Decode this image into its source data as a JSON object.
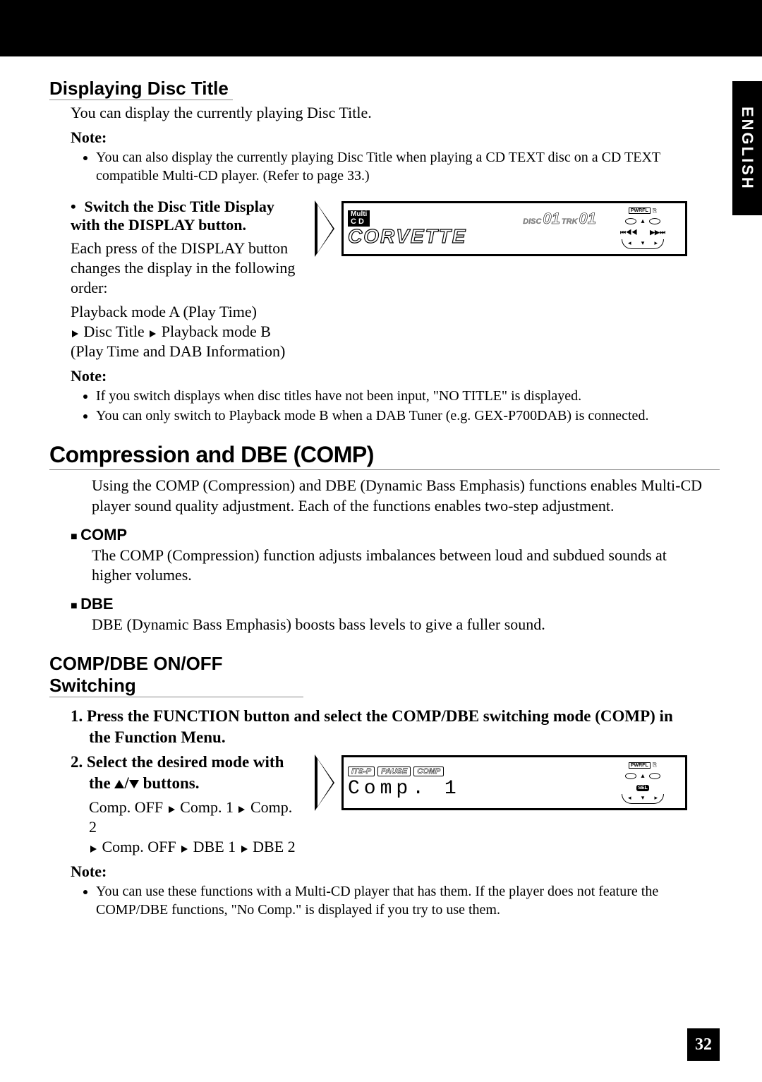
{
  "side_tab": "ENGLISH",
  "section1": {
    "heading": "Displaying Disc Title",
    "intro": "You can display the currently playing Disc Title.",
    "note1_label": "Note:",
    "note1_items": [
      "You can also display the currently playing Disc Title when playing a CD TEXT disc on a CD TEXT compatible Multi-CD player. (Refer to page 33.)"
    ],
    "step_lead_bullet": "•",
    "step_lead": "Switch the Disc Title Display with the DISPLAY button.",
    "step_body_1": "Each press of the DISPLAY button changes the display in the following order:",
    "step_body_2a": "Playback mode A (Play Time)",
    "step_body_2b": " Disc Title ",
    "step_body_2c": " Playback mode B (Play Time and DAB Information)",
    "lcd": {
      "multi_top": "Multi",
      "multi_bot": "C  D",
      "disc_lbl": "DISC",
      "disc_num": "01",
      "trk_lbl": "TRK",
      "trk_num": "01",
      "title": "CORVETTE",
      "pwrfl": "PWRFL"
    },
    "note2_label": "Note:",
    "note2_items": [
      "If you switch displays when disc titles have not been input, \"NO TITLE\" is displayed.",
      "You can only switch to Playback mode B when a DAB Tuner (e.g. GEX-P700DAB) is connected."
    ]
  },
  "section2": {
    "heading": "Compression and DBE (COMP)",
    "intro": "Using the COMP (Compression) and DBE (Dynamic Bass Emphasis) functions enables Multi-CD player sound quality adjustment. Each of the functions enables two-step adjustment.",
    "comp_head": "COMP",
    "comp_text": "The COMP (Compression) function adjusts imbalances between loud and subdued sounds at higher volumes.",
    "dbe_head": "DBE",
    "dbe_text": "DBE (Dynamic Bass Emphasis) boosts bass levels to give a fuller sound."
  },
  "section3": {
    "heading": "COMP/DBE ON/OFF Switching",
    "step1": "1.  Press the FUNCTION button and select the COMP/DBE switching mode (COMP) in the Function Menu.",
    "step2_lead_a": "2.  Select the desired mode with the ",
    "step2_lead_b": " buttons.",
    "step2_body_a": "Comp. OFF ",
    "step2_body_b": " Comp. 1 ",
    "step2_body_c": " Comp. 2 ",
    "step2_body_d": " Comp. OFF ",
    "step2_body_e": " DBE 1 ",
    "step2_body_f": " DBE 2",
    "lcd": {
      "tag1": "ITS-P",
      "tag2": "PAUSE",
      "tag3": "COMP",
      "text": "Comp. 1",
      "pwrfl": "PWRFL",
      "sel": "SEL"
    },
    "note_label": "Note:",
    "note_items": [
      "You can use these functions with a Multi-CD player that has them. If the player does not feature the COMP/DBE functions, \"No Comp.\" is displayed if you try to use them."
    ]
  },
  "page_number": "32"
}
